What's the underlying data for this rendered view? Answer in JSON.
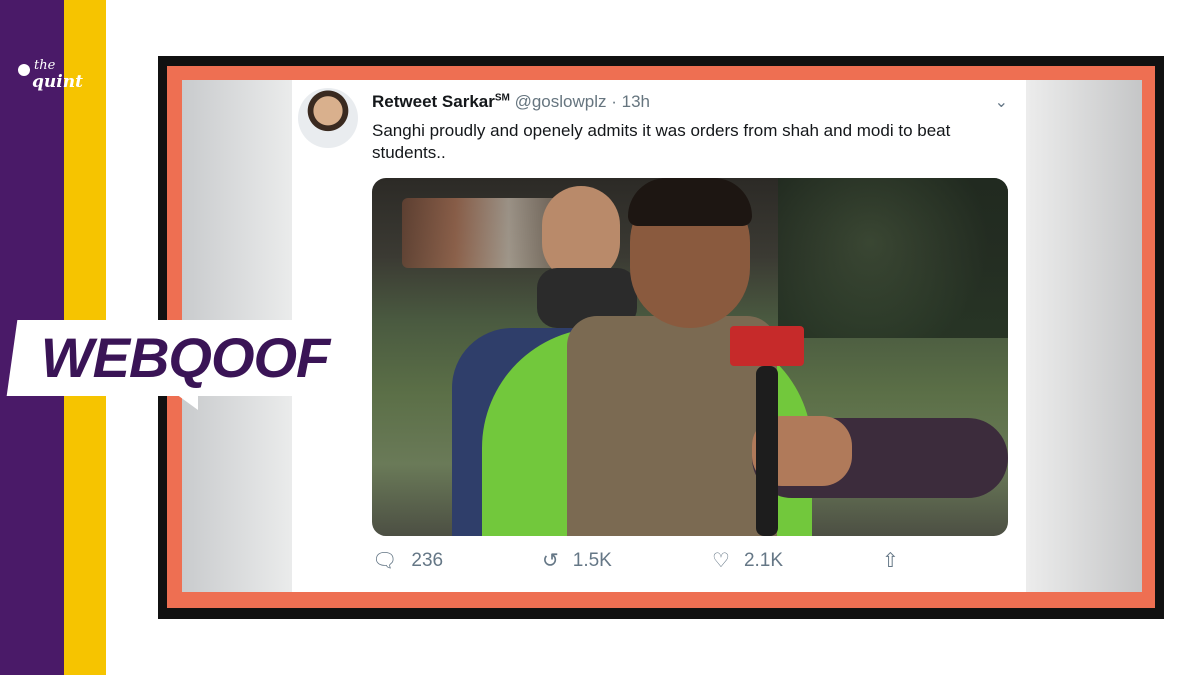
{
  "brand": {
    "logo_line1": "the",
    "logo_line2": "quint",
    "banner": "WEBQOOF",
    "colors": {
      "purple": "#4a1a68",
      "yellow": "#f6c400",
      "frame_orange": "#ee6f52"
    }
  },
  "tweet": {
    "display_name": "Retweet Sarkar",
    "name_suffix": "SM",
    "handle": "@goslowplz",
    "separator": "·",
    "time": "13h",
    "text": "Sanghi proudly and openely admits it was orders from shah and modi to beat students..",
    "media_icon": "video-still",
    "actions": {
      "replies": "236",
      "retweets": "1.5K",
      "likes": "2.1K"
    },
    "icons": {
      "menu": "chevron-down-icon",
      "reply": "reply-icon",
      "retweet": "retweet-icon",
      "like": "heart-icon",
      "share": "share-icon"
    }
  }
}
